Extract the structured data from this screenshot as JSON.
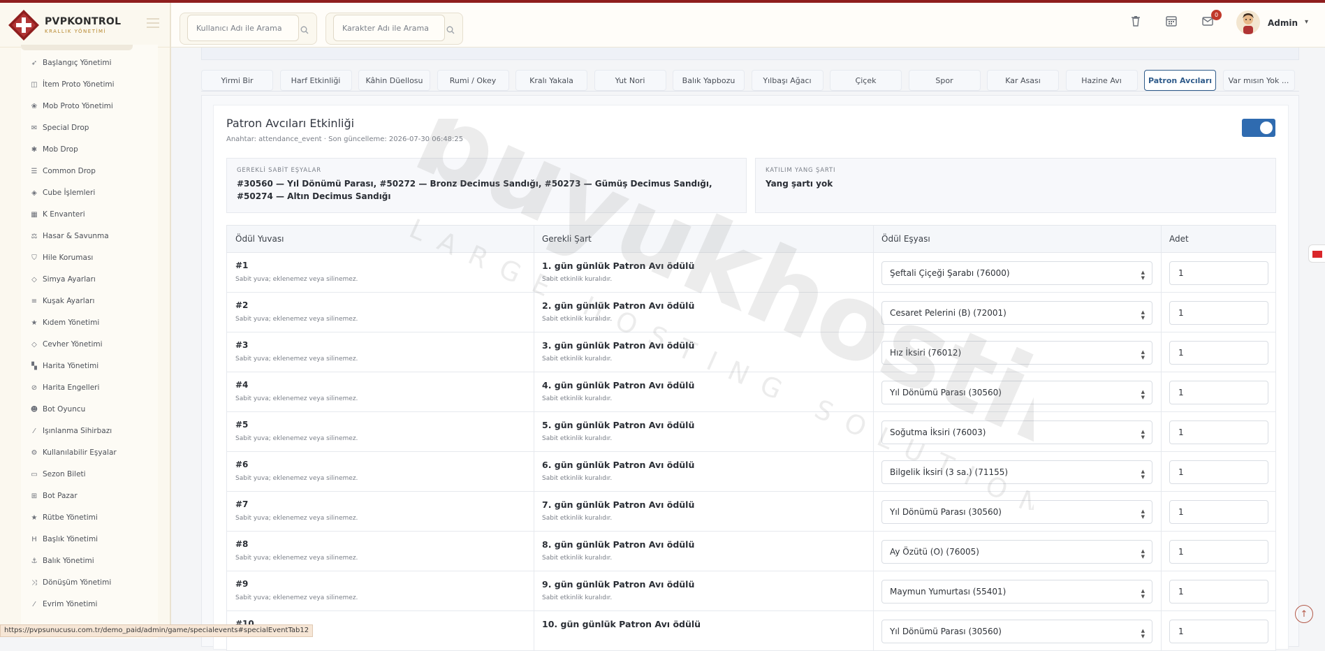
{
  "brand": {
    "title": "PVPKONTROL",
    "subtitle": "KRALLIK YÖNETİMİ"
  },
  "topbar": {
    "search_user_placeholder": "Kullanıcı Adı ile Arama",
    "search_char_placeholder": "Karakter Adı ile Arama",
    "notification_count": "0",
    "user_name": "Admin"
  },
  "sidebar": {
    "items": [
      {
        "label": "Başlangıç Yönetimi",
        "icon": "rocket-icon"
      },
      {
        "label": "İtem Proto Yönetimi",
        "icon": "box-icon"
      },
      {
        "label": "Mob Proto Yönetimi",
        "icon": "paw-icon"
      },
      {
        "label": "Special Drop",
        "icon": "gift-icon"
      },
      {
        "label": "Mob Drop",
        "icon": "bug-icon"
      },
      {
        "label": "Common Drop",
        "icon": "list-icon"
      },
      {
        "label": "Cube İşlemleri",
        "icon": "cube-icon"
      },
      {
        "label": "K Envanteri",
        "icon": "grid-icon"
      },
      {
        "label": "Hasar & Savunma",
        "icon": "scale-icon"
      },
      {
        "label": "Hile Koruması",
        "icon": "shield-icon"
      },
      {
        "label": "Simya Ayarları",
        "icon": "gem-icon"
      },
      {
        "label": "Kuşak Ayarları",
        "icon": "sliders-icon"
      },
      {
        "label": "Kıdem Yönetimi",
        "icon": "star-icon"
      },
      {
        "label": "Cevher Yönetimi",
        "icon": "gem-icon"
      },
      {
        "label": "Harita Yönetimi",
        "icon": "map-icon"
      },
      {
        "label": "Harita Engelleri",
        "icon": "ban-icon"
      },
      {
        "label": "Bot Oyuncu",
        "icon": "robot-icon"
      },
      {
        "label": "Işınlanma Sihirbazı",
        "icon": "wand-icon"
      },
      {
        "label": "Kullanılabilir Eşyalar",
        "icon": "cogs-icon"
      },
      {
        "label": "Sezon Bileti",
        "icon": "ticket-icon"
      },
      {
        "label": "Bot Pazar",
        "icon": "cart-icon"
      },
      {
        "label": "Rütbe Yönetimi",
        "icon": "star-icon"
      },
      {
        "label": "Başlık Yönetimi",
        "icon": "heading-icon"
      },
      {
        "label": "Balık Yönetimi",
        "icon": "anchor-icon"
      },
      {
        "label": "Dönüşüm Yönetimi",
        "icon": "shuffle-icon"
      },
      {
        "label": "Evrim Yönetimi",
        "icon": "wand-icon"
      }
    ]
  },
  "tabs": [
    {
      "label": "Yirmi Bir"
    },
    {
      "label": "Harf Etkinliği"
    },
    {
      "label": "Kâhin Düellosu"
    },
    {
      "label": "Rumi / Okey"
    },
    {
      "label": "Kralı Yakala"
    },
    {
      "label": "Yut Nori"
    },
    {
      "label": "Balık Yapbozu"
    },
    {
      "label": "Yılbaşı Ağacı"
    },
    {
      "label": "Çiçek"
    },
    {
      "label": "Spor"
    },
    {
      "label": "Kar Asası"
    },
    {
      "label": "Hazine Avı"
    },
    {
      "label": "Patron Avcıları",
      "active": true
    },
    {
      "label": "Var mısın Yok ..."
    }
  ],
  "event": {
    "title": "Patron Avcıları Etkinliği",
    "meta": "Anahtar: attendance_event · Son güncelleme: 2026-07-30 06:48:25",
    "enabled": true,
    "required_items_label": "GEREKLİ SABİT EŞYALAR",
    "required_items_value": "#30560 — Yıl Dönümü Parası, #50272 — Bronz Decimus Sandığı, #50273 — Gümüş Decimus Sandığı, #50274 — Altın Decimus Sandığı",
    "yang_label": "KATILIM YANG ŞARTI",
    "yang_value": "Yang şartı yok"
  },
  "table": {
    "headers": {
      "slot": "Ödül Yuvası",
      "condition": "Gerekli Şart",
      "item": "Ödül Eşyası",
      "qty": "Adet"
    },
    "rows": [
      {
        "slot": "#1",
        "slot_note": "Sabit yuva; eklenemez veya silinemez.",
        "condition": "1. gün günlük Patron Avı ödülü",
        "condition_note": "Sabit etkinlik kuralıdır.",
        "item": "Şeftali Çiçeği Şarabı (76000)",
        "qty": "1"
      },
      {
        "slot": "#2",
        "slot_note": "Sabit yuva; eklenemez veya silinemez.",
        "condition": "2. gün günlük Patron Avı ödülü",
        "condition_note": "Sabit etkinlik kuralıdır.",
        "item": "Cesaret Pelerini (B) (72001)",
        "qty": "1"
      },
      {
        "slot": "#3",
        "slot_note": "Sabit yuva; eklenemez veya silinemez.",
        "condition": "3. gün günlük Patron Avı ödülü",
        "condition_note": "Sabit etkinlik kuralıdır.",
        "item": "Hız İksiri (76012)",
        "qty": "1"
      },
      {
        "slot": "#4",
        "slot_note": "Sabit yuva; eklenemez veya silinemez.",
        "condition": "4. gün günlük Patron Avı ödülü",
        "condition_note": "Sabit etkinlik kuralıdır.",
        "item": "Yıl Dönümü Parası (30560)",
        "qty": "1"
      },
      {
        "slot": "#5",
        "slot_note": "Sabit yuva; eklenemez veya silinemez.",
        "condition": "5. gün günlük Patron Avı ödülü",
        "condition_note": "Sabit etkinlik kuralıdır.",
        "item": "Soğutma İksiri (76003)",
        "qty": "1"
      },
      {
        "slot": "#6",
        "slot_note": "Sabit yuva; eklenemez veya silinemez.",
        "condition": "6. gün günlük Patron Avı ödülü",
        "condition_note": "Sabit etkinlik kuralıdır.",
        "item": "Bilgelik İksiri (3 sa.) (71155)",
        "qty": "1"
      },
      {
        "slot": "#7",
        "slot_note": "Sabit yuva; eklenemez veya silinemez.",
        "condition": "7. gün günlük Patron Avı ödülü",
        "condition_note": "Sabit etkinlik kuralıdır.",
        "item": "Yıl Dönümü Parası (30560)",
        "qty": "1"
      },
      {
        "slot": "#8",
        "slot_note": "Sabit yuva; eklenemez veya silinemez.",
        "condition": "8. gün günlük Patron Avı ödülü",
        "condition_note": "Sabit etkinlik kuralıdır.",
        "item": "Ay Özütü (O) (76005)",
        "qty": "1"
      },
      {
        "slot": "#9",
        "slot_note": "Sabit yuva; eklenemez veya silinemez.",
        "condition": "9. gün günlük Patron Avı ödülü",
        "condition_note": "Sabit etkinlik kuralıdır.",
        "item": "Maymun Yumurtası (55401)",
        "qty": "1"
      },
      {
        "slot": "#10",
        "slot_note": "",
        "condition": "10. gün günlük Patron Avı ödülü",
        "condition_note": "",
        "item": "Yıl Dönümü Parası (30560)",
        "qty": "1"
      }
    ]
  },
  "watermark": {
    "main": "buyukhosting",
    "sub": "LARGE HOSTING SOLUTIONS"
  },
  "statusbar": {
    "url": "https://pvpsunucusu.com.tr/demo_paid/admin/game/specialevents#specialEventTab12"
  },
  "colors": {
    "accent": "#2f5b8a",
    "brand": "#8f1e1e",
    "toggle": "#2f6bb0"
  }
}
